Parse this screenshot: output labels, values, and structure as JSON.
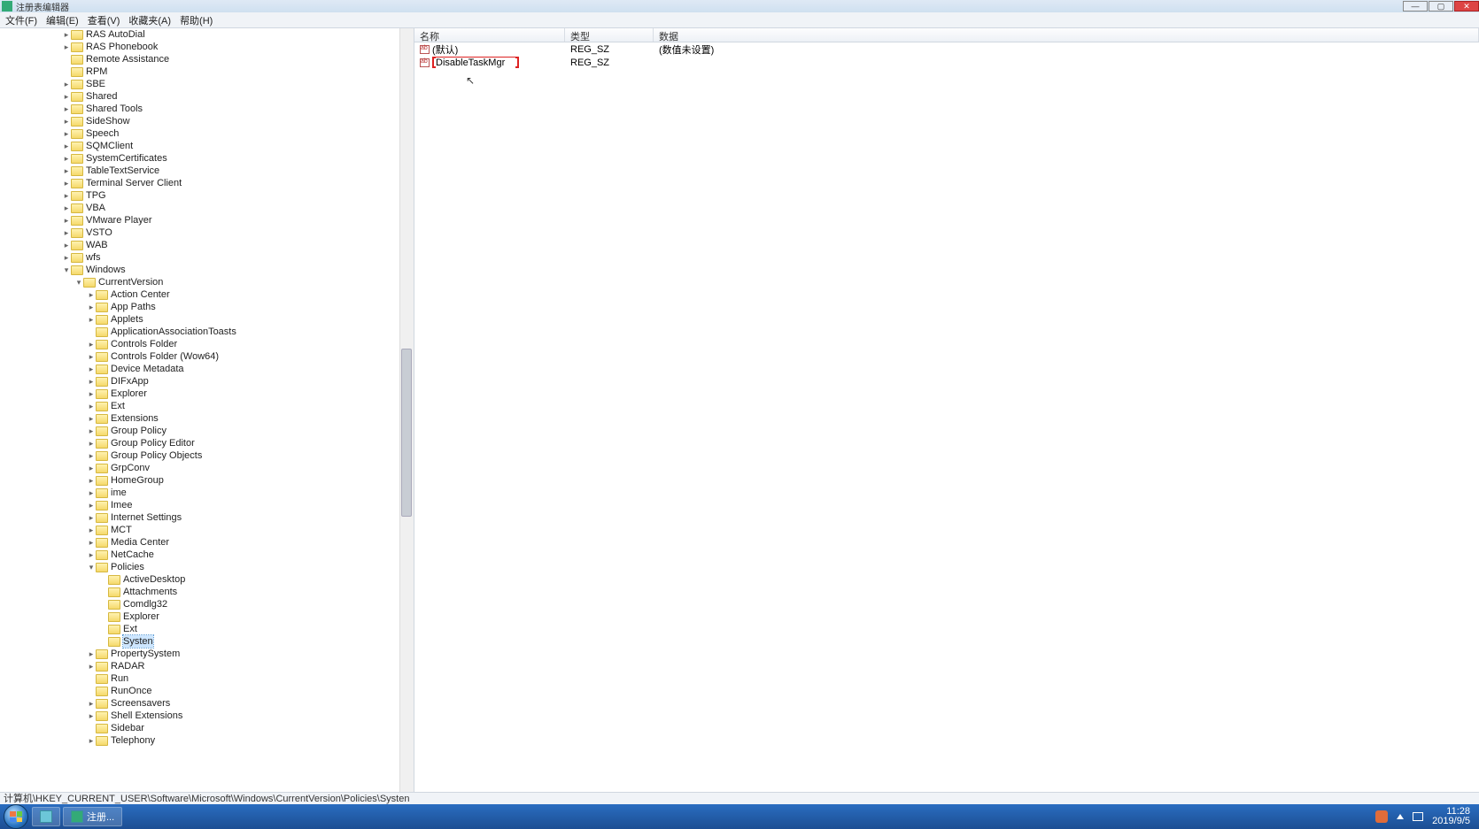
{
  "window": {
    "title": "注册表编辑器",
    "min": "—",
    "max": "▢",
    "close": "✕"
  },
  "menu": {
    "file": "文件(F)",
    "edit": "编辑(E)",
    "view": "查看(V)",
    "favorites": "收藏夹(A)",
    "help": "帮助(H)"
  },
  "tree": [
    {
      "indent": 5,
      "arrow": "r",
      "label": "RAS AutoDial"
    },
    {
      "indent": 5,
      "arrow": "r",
      "label": "RAS Phonebook"
    },
    {
      "indent": 5,
      "arrow": "n",
      "label": "Remote Assistance"
    },
    {
      "indent": 5,
      "arrow": "n",
      "label": "RPM"
    },
    {
      "indent": 5,
      "arrow": "r",
      "label": "SBE"
    },
    {
      "indent": 5,
      "arrow": "r",
      "label": "Shared"
    },
    {
      "indent": 5,
      "arrow": "r",
      "label": "Shared Tools"
    },
    {
      "indent": 5,
      "arrow": "r",
      "label": "SideShow"
    },
    {
      "indent": 5,
      "arrow": "r",
      "label": "Speech"
    },
    {
      "indent": 5,
      "arrow": "r",
      "label": "SQMClient"
    },
    {
      "indent": 5,
      "arrow": "r",
      "label": "SystemCertificates"
    },
    {
      "indent": 5,
      "arrow": "r",
      "label": "TableTextService"
    },
    {
      "indent": 5,
      "arrow": "r",
      "label": "Terminal Server Client"
    },
    {
      "indent": 5,
      "arrow": "r",
      "label": "TPG"
    },
    {
      "indent": 5,
      "arrow": "r",
      "label": "VBA"
    },
    {
      "indent": 5,
      "arrow": "r",
      "label": "VMware Player"
    },
    {
      "indent": 5,
      "arrow": "r",
      "label": "VSTO"
    },
    {
      "indent": 5,
      "arrow": "r",
      "label": "WAB"
    },
    {
      "indent": 5,
      "arrow": "r",
      "label": "wfs"
    },
    {
      "indent": 5,
      "arrow": "d",
      "label": "Windows"
    },
    {
      "indent": 6,
      "arrow": "d",
      "label": "CurrentVersion"
    },
    {
      "indent": 7,
      "arrow": "r",
      "label": "Action Center"
    },
    {
      "indent": 7,
      "arrow": "r",
      "label": "App Paths"
    },
    {
      "indent": 7,
      "arrow": "r",
      "label": "Applets"
    },
    {
      "indent": 7,
      "arrow": "n",
      "label": "ApplicationAssociationToasts"
    },
    {
      "indent": 7,
      "arrow": "r",
      "label": "Controls Folder"
    },
    {
      "indent": 7,
      "arrow": "r",
      "label": "Controls Folder (Wow64)"
    },
    {
      "indent": 7,
      "arrow": "r",
      "label": "Device Metadata"
    },
    {
      "indent": 7,
      "arrow": "r",
      "label": "DIFxApp"
    },
    {
      "indent": 7,
      "arrow": "r",
      "label": "Explorer"
    },
    {
      "indent": 7,
      "arrow": "r",
      "label": "Ext"
    },
    {
      "indent": 7,
      "arrow": "r",
      "label": "Extensions"
    },
    {
      "indent": 7,
      "arrow": "r",
      "label": "Group Policy"
    },
    {
      "indent": 7,
      "arrow": "r",
      "label": "Group Policy Editor"
    },
    {
      "indent": 7,
      "arrow": "r",
      "label": "Group Policy Objects"
    },
    {
      "indent": 7,
      "arrow": "r",
      "label": "GrpConv"
    },
    {
      "indent": 7,
      "arrow": "r",
      "label": "HomeGroup"
    },
    {
      "indent": 7,
      "arrow": "r",
      "label": "ime"
    },
    {
      "indent": 7,
      "arrow": "r",
      "label": "Imee"
    },
    {
      "indent": 7,
      "arrow": "r",
      "label": "Internet Settings"
    },
    {
      "indent": 7,
      "arrow": "r",
      "label": "MCT"
    },
    {
      "indent": 7,
      "arrow": "r",
      "label": "Media Center"
    },
    {
      "indent": 7,
      "arrow": "r",
      "label": "NetCache"
    },
    {
      "indent": 7,
      "arrow": "d",
      "label": "Policies"
    },
    {
      "indent": 8,
      "arrow": "n",
      "label": "ActiveDesktop"
    },
    {
      "indent": 8,
      "arrow": "n",
      "label": "Attachments"
    },
    {
      "indent": 8,
      "arrow": "n",
      "label": "Comdlg32"
    },
    {
      "indent": 8,
      "arrow": "n",
      "label": "Explorer"
    },
    {
      "indent": 8,
      "arrow": "n",
      "label": "Ext"
    },
    {
      "indent": 8,
      "arrow": "n",
      "label": "Systen",
      "selected": true
    },
    {
      "indent": 7,
      "arrow": "r",
      "label": "PropertySystem"
    },
    {
      "indent": 7,
      "arrow": "r",
      "label": "RADAR"
    },
    {
      "indent": 7,
      "arrow": "n",
      "label": "Run"
    },
    {
      "indent": 7,
      "arrow": "n",
      "label": "RunOnce"
    },
    {
      "indent": 7,
      "arrow": "r",
      "label": "Screensavers"
    },
    {
      "indent": 7,
      "arrow": "r",
      "label": "Shell Extensions"
    },
    {
      "indent": 7,
      "arrow": "n",
      "label": "Sidebar"
    },
    {
      "indent": 7,
      "arrow": "r",
      "label": "Telephony"
    }
  ],
  "list": {
    "headers": {
      "name": "名称",
      "type": "类型",
      "data": "数据"
    },
    "rows": [
      {
        "name": "(默认)",
        "type": "REG_SZ",
        "data": "(数值未设置)",
        "editing": false
      },
      {
        "name": "DisableTaskMgr",
        "type": "REG_SZ",
        "data": "",
        "editing": true
      }
    ]
  },
  "status": {
    "path": "计算机\\HKEY_CURRENT_USER\\Software\\Microsoft\\Windows\\CurrentVersion\\Policies\\Systen"
  },
  "taskbar": {
    "app1": "注册...",
    "time": "11:28",
    "date": "2019/9/5"
  }
}
